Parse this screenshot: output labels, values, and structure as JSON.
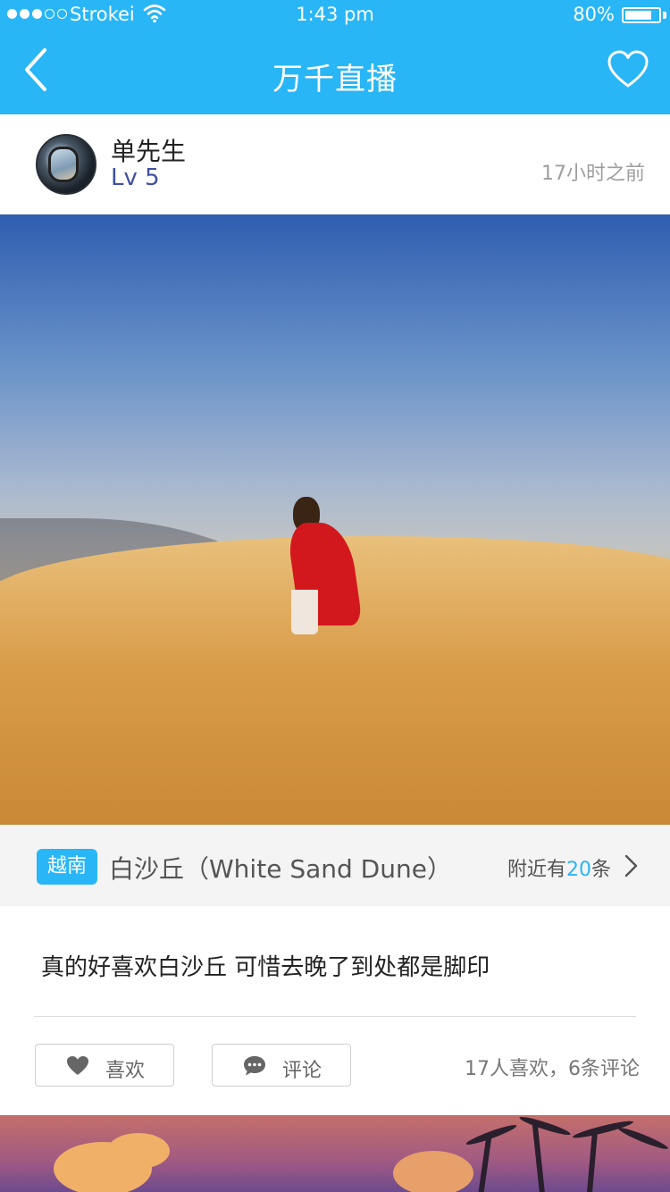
{
  "status_bar": {
    "carrier": "Strokei",
    "time": "1:43 pm",
    "battery": "80%",
    "battery_level": 0.8
  },
  "nav": {
    "title": "万千直播"
  },
  "post": {
    "user": {
      "name": "单先生",
      "level": "Lv 5"
    },
    "time_ago": "17小时之前",
    "location": {
      "country_tag": "越南",
      "name": "白沙丘（White Sand Dune）",
      "nearby_prefix": "附近有",
      "nearby_count": "20",
      "nearby_suffix": "条"
    },
    "text": "真的好喜欢白沙丘 可惜去晚了到处都是脚印",
    "actions": {
      "like_label": "喜欢",
      "comment_label": "评论"
    },
    "stats": "17人喜欢，6条评论"
  },
  "colors": {
    "accent": "#29b6f6",
    "level": "#3f51a3",
    "muted": "#9e9e9e"
  }
}
